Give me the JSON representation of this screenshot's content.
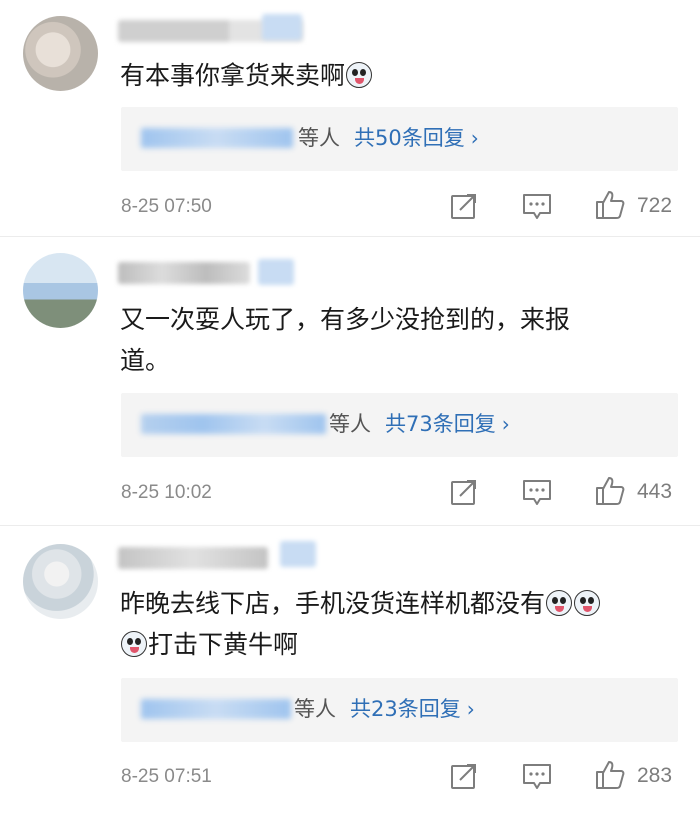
{
  "comments": [
    {
      "text": "有本事你拿货来卖啊",
      "emoji_after": 1,
      "reply_suffix": "等人",
      "reply_count": "共50条回复",
      "time": "8-25 07:50",
      "likes": "722"
    },
    {
      "text_line1": "又一次耍人玩了，有多少没抢到的，来报",
      "text_line2": "道。",
      "reply_suffix": "等人",
      "reply_count": "共73条回复",
      "time": "8-25 10:02",
      "likes": "443"
    },
    {
      "text_line1": "昨晚去线下店，手机没货连样机都没有",
      "text_line2": "打击下黄牛啊",
      "reply_suffix": "等人",
      "reply_count": "共23条回复",
      "time": "8-25 07:51",
      "likes": "283"
    }
  ],
  "icons": {
    "share": "share-icon",
    "comment": "comment-icon",
    "like": "thumbs-up-icon",
    "reply_more": "chevron-right-icon",
    "emoji": "crying-emoji-icon"
  },
  "colors": {
    "link_blue": "#2f6fb6",
    "meta_gray": "#8a8a8a",
    "reply_bg": "#f4f4f4"
  }
}
